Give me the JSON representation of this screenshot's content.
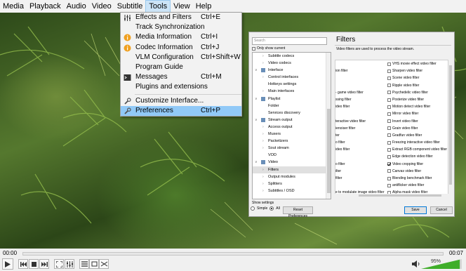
{
  "menubar": {
    "items": [
      "Media",
      "Playback",
      "Audio",
      "Video",
      "Subtitle",
      "Tools",
      "View",
      "Help"
    ],
    "active": "Tools"
  },
  "tools_menu": {
    "items": [
      {
        "label": "Effects and Filters",
        "shortcut": "Ctrl+E",
        "icon": "sliders-icon"
      },
      {
        "label": "Track Synchronization",
        "shortcut": "",
        "icon": ""
      },
      {
        "label": "Media Information",
        "shortcut": "Ctrl+I",
        "icon": "info-icon"
      },
      {
        "label": "Codec Information",
        "shortcut": "Ctrl+J",
        "icon": "info-icon"
      },
      {
        "label": "VLM Configuration",
        "shortcut": "Ctrl+Shift+W",
        "icon": ""
      },
      {
        "label": "Program Guide",
        "shortcut": "",
        "icon": ""
      },
      {
        "label": "Messages",
        "shortcut": "Ctrl+M",
        "icon": "terminal-icon"
      },
      {
        "label": "Plugins and extensions",
        "shortcut": "",
        "icon": ""
      },
      {
        "label": "Customize Interface...",
        "shortcut": "",
        "icon": "wrench-icon"
      },
      {
        "label": "Preferences",
        "shortcut": "Ctrl+P",
        "icon": "wrench-icon",
        "highlighted": true
      }
    ]
  },
  "prefs": {
    "search_placeholder": "Search",
    "only_show_current": "Only show current",
    "tree": [
      {
        "label": "Subtitle codecs",
        "level": 2
      },
      {
        "label": "Video codecs",
        "level": 2
      },
      {
        "label": "Interface",
        "level": 1
      },
      {
        "label": "Control interfaces",
        "level": 2
      },
      {
        "label": "Hotkeys settings",
        "level": 3
      },
      {
        "label": "Main interfaces",
        "level": 2
      },
      {
        "label": "Playlist",
        "level": 1
      },
      {
        "label": "Folder",
        "level": 3
      },
      {
        "label": "Services discovery",
        "level": 3
      },
      {
        "label": "Stream output",
        "level": 1
      },
      {
        "label": "Access output",
        "level": 2
      },
      {
        "label": "Muxers",
        "level": 2
      },
      {
        "label": "Packetizers",
        "level": 2
      },
      {
        "label": "Sout stream",
        "level": 2
      },
      {
        "label": "VOD",
        "level": 3
      },
      {
        "label": "Video",
        "level": 1
      },
      {
        "label": "Filters",
        "level": 2,
        "selected": true
      },
      {
        "label": "Output modules",
        "level": 2
      },
      {
        "label": "Splitters",
        "level": 2
      },
      {
        "label": "Subtitles / OSD",
        "level": 2
      }
    ],
    "show_settings": "Show settings",
    "simple": "Simple",
    "all": "All",
    "reset": "Reset Preferences",
    "save": "Save",
    "cancel": "Cancel",
    "title": "Filters",
    "description": "Video filters are used to process the video stream.",
    "filter_rows": [
      {
        "left": "",
        "right": "VHS movie effect video filter"
      },
      {
        "left": "ion filter",
        "right": "Sharpen video filter"
      },
      {
        "left": "",
        "right": "Scene video filter"
      },
      {
        "left": "",
        "right": "Ripple video filter"
      },
      {
        "left": "- game video filter",
        "right": "Psychedelic video filter"
      },
      {
        "left": "ssing filter",
        "right": "Posterize video filter"
      },
      {
        "left": "ideo filter",
        "right": "Motion detect video filter"
      },
      {
        "left": "",
        "right": "Mirror video filter"
      },
      {
        "left": "teractive video filter",
        "right": "Invert video filter"
      },
      {
        "left": "ienoiser filter",
        "right": "Grain video filter"
      },
      {
        "left": "ter",
        "right": "Gradfun video filter"
      },
      {
        "left": "o filter",
        "right": "Freezing interactive video filter"
      },
      {
        "left": "ideo filter",
        "right": "Extract RGB component video filter"
      },
      {
        "left": "",
        "right": "Edge detection video filter"
      },
      {
        "left": "o filter",
        "right": "Video cropping filter"
      },
      {
        "left": "ilter",
        "right": "Canvas video filter"
      },
      {
        "left": "filter",
        "right": "Blending benchmark filter"
      },
      {
        "left": "",
        "right": "antiflicker video filter"
      },
      {
        "left": "e to modulate image video filter",
        "right": "Alpha mask video filter"
      }
    ],
    "checked_filter_index": 14
  },
  "player": {
    "time_elapsed": "00:00",
    "time_total": "00:07",
    "volume": "95%",
    "volume_fraction": 0.95
  }
}
